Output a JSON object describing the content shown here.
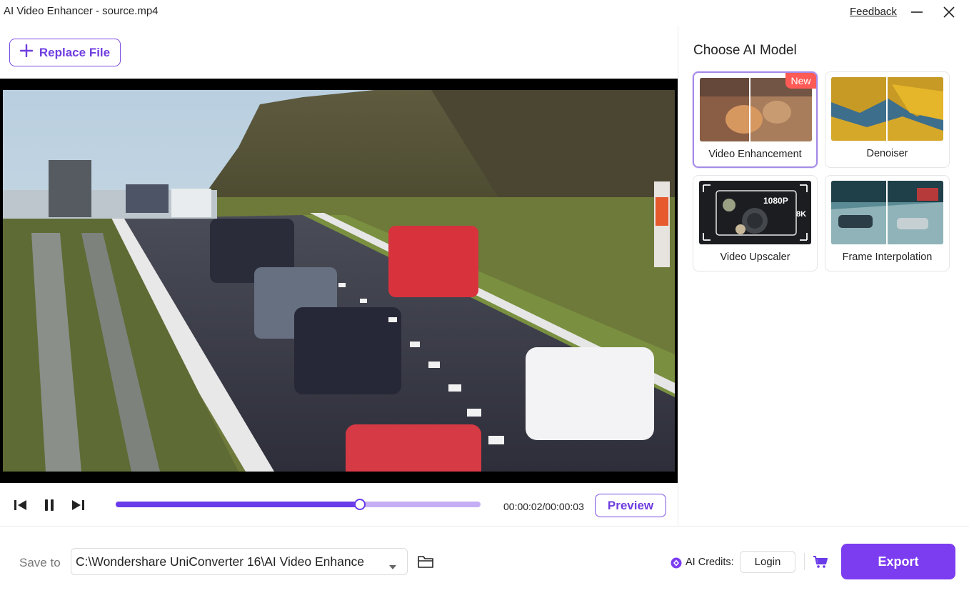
{
  "window": {
    "title": "AI Video Enhancer - source.mp4",
    "feedback_label": "Feedback"
  },
  "toolbar": {
    "replace_file_label": "Replace File"
  },
  "player": {
    "current_time": "00:00:02",
    "total_time": "00:00:03",
    "timecode": "00:00:02/00:00:03",
    "progress_fraction": 0.67,
    "preview_label": "Preview"
  },
  "model_panel": {
    "title": "Choose AI Model",
    "selected": "Video Enhancement",
    "models": [
      {
        "label": "Video Enhancement",
        "badge": "New",
        "selected": true
      },
      {
        "label": "Denoiser",
        "badge": "",
        "selected": false
      },
      {
        "label": "Video Upscaler",
        "badge": "",
        "selected": false,
        "thumb_text_a": "1080P",
        "thumb_text_b": "8K"
      },
      {
        "label": "Frame Interpolation",
        "badge": "",
        "selected": false
      }
    ]
  },
  "bottom_bar": {
    "save_to_label": "Save to",
    "save_path": "C:\\Wondershare UniConverter 16\\AI Video Enhance",
    "credits_label": "AI Credits:",
    "login_label": "Login",
    "export_label": "Export"
  },
  "icons": {
    "add": "plus-icon",
    "minimize": "minimize-icon",
    "close": "close-icon",
    "prev_frame": "previous-frame-icon",
    "pause": "pause-icon",
    "next_frame": "next-frame-icon",
    "folder": "folder-icon",
    "credits": "credits-diamond-icon",
    "cart": "cart-icon",
    "dropdown": "chevron-down-icon"
  },
  "colors": {
    "accent": "#7c3cf0",
    "accent_border": "#7b4ce0",
    "progress_track": "#c5aef5",
    "progress_fill": "#6a3be8",
    "badge_new": "#ff5a55"
  }
}
